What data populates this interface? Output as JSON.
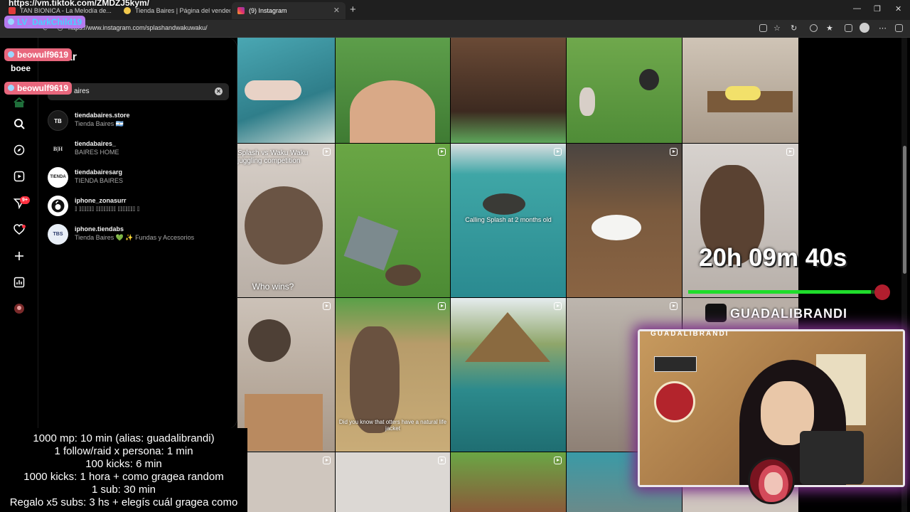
{
  "browser": {
    "tabs": [
      {
        "label": "TAN BIONICA - La Melodía de...",
        "active": false
      },
      {
        "label": "Tienda Baires | Página del vendedor",
        "active": false
      },
      {
        "label": "(9) Instagram",
        "active": true
      }
    ],
    "url": "https://www.instagram.com/splashandwakuwaku/"
  },
  "search": {
    "title": "car",
    "query": "aires",
    "results": [
      {
        "username": "tiendabaires.store",
        "name": "Tienda Baires 🇦🇷",
        "avatar_text": "TB"
      },
      {
        "username": "tiendabaires_",
        "name": "BAIRES HOME",
        "avatar_text": "B|H"
      },
      {
        "username": "tiendabairesarg",
        "name": "TIENDA BAIRES",
        "avatar_text": "TIENDA"
      },
      {
        "username": "iphone_zonasurr",
        "name": "𝕀 𝕀𝕀𝕀𝕀𝕀𝕀 𝕀𝕀𝕀𝕀𝕀𝕀𝕀𝕀 𝕀𝕀𝕀𝕀𝕀𝕀𝕀 𝕀",
        "avatar_text": ""
      },
      {
        "username": "iphone.tiendabs",
        "name": "Tienda Baires 💚 ✨ Fundas y Accesorios",
        "avatar_text": "TBS"
      }
    ]
  },
  "sidebar": {
    "notifications_badge": "9+",
    "icons": [
      "home-icon",
      "search-icon",
      "explore-icon",
      "reels-icon",
      "messages-icon",
      "notifications-icon",
      "create-icon",
      "dashboard-icon",
      "profile-icon"
    ]
  },
  "grid": {
    "captions": {
      "juggling": "Splash vs Waku Waku juggling competition",
      "who_wins": "Who wins?",
      "calling": "Calling Splash at 2 months old",
      "life_jacket": "Did you know that otters have a natural life jacket"
    }
  },
  "overlay": {
    "tiktok_url": "https://vm.tiktok.com/ZMDZJ5kym/",
    "chat": [
      {
        "user": "LV_DarkChild19",
        "message": ""
      },
      {
        "user": "beowulf9619",
        "message": "boee"
      },
      {
        "user": "beowulf9619",
        "message": ""
      }
    ],
    "rules": [
      "1000 mp: 10 min (alias: guadalibrandi)",
      "1 follow/raid x persona: 1 min",
      "100 kicks: 6 min",
      "1000 kicks: 1 hora + como gragea random",
      "1 sub: 30 min",
      "Regalo x5 subs: 3 hs + elegís cuál gragea como"
    ],
    "timer": "20h 09m 40s",
    "timer_progress": 0.98,
    "streamer": "GUADALIBRANDI",
    "cam_label": "GUADALIBRANDI"
  }
}
